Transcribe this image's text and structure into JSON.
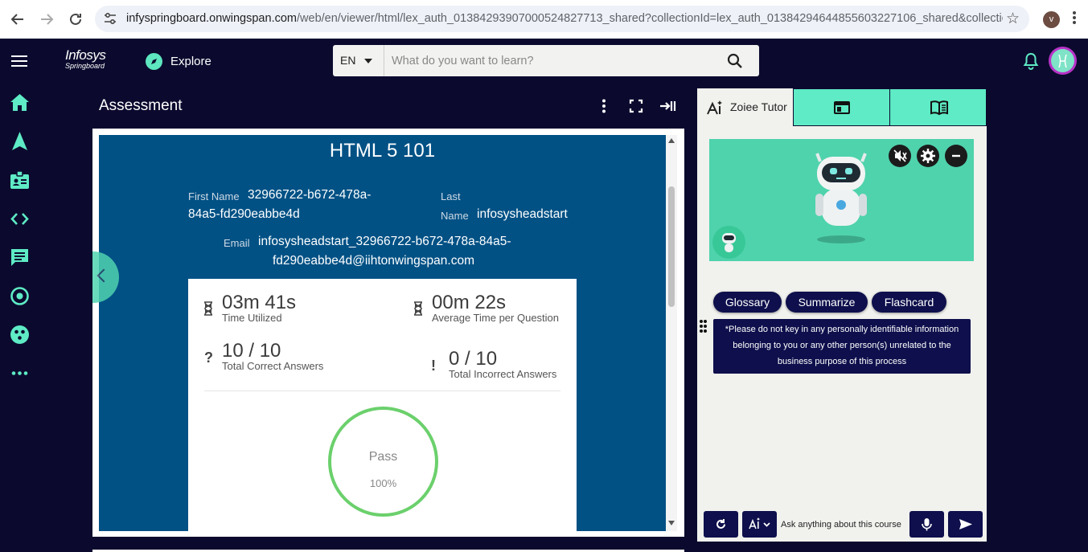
{
  "browser": {
    "url_host": "infyspringboard.onwingspan.com",
    "url_path": "/web/en/viewer/html/lex_auth_0138429390700052482771­3_shared?collectionId=lex_auth_0138429464485560322710­6_shared&collectionTy...",
    "profile_initial": "v"
  },
  "header": {
    "logo_line1": "Infosys",
    "logo_line2": "Springboard",
    "explore_label": "Explore",
    "language": "EN",
    "search_placeholder": "What do you want to learn?"
  },
  "content": {
    "title": "Assessment"
  },
  "result": {
    "quiz_title": "HTML 5 101",
    "first_name_label": "First Name",
    "first_name_line1": "32966722-b672-478a-",
    "first_name_line2": "84a5-fd290eabbe4d",
    "last_name_label_1": "Last",
    "last_name_label_2": "Name",
    "last_name": "infosysheadstart",
    "email_label": "Email",
    "email_line1": "infosysheadstart_32966722-b672-478a-84a5-",
    "email_line2": "fd290eabbe4d@iihtonwingspan.com",
    "time_utilized_value": "03m 41s",
    "time_utilized_label": "Time Utilized",
    "avg_time_value": "00m 22s",
    "avg_time_label": "Average Time per Question",
    "correct_value": "10 / 10",
    "correct_label": "Total Correct Answers",
    "incorrect_value": "0 / 10",
    "incorrect_label": "Total Incorrect Answers",
    "status": "Pass",
    "percent": "100%",
    "pass_color": "#6bd06c"
  },
  "tutor": {
    "tab_label": "Zoiee Tutor",
    "chips": [
      "Glossary",
      "Summarize",
      "Flashcard"
    ],
    "notice": "*Please do not key in any personally identifiable information belonging to you or any other person(s) unrelated to the business purpose of this process",
    "input_placeholder": "Ask anything about this course"
  },
  "colors": {
    "background": "#0b0a2e",
    "accent_teal": "#5eebc5",
    "panel_navy": "#015185",
    "chip_navy": "#0e0f4c"
  }
}
